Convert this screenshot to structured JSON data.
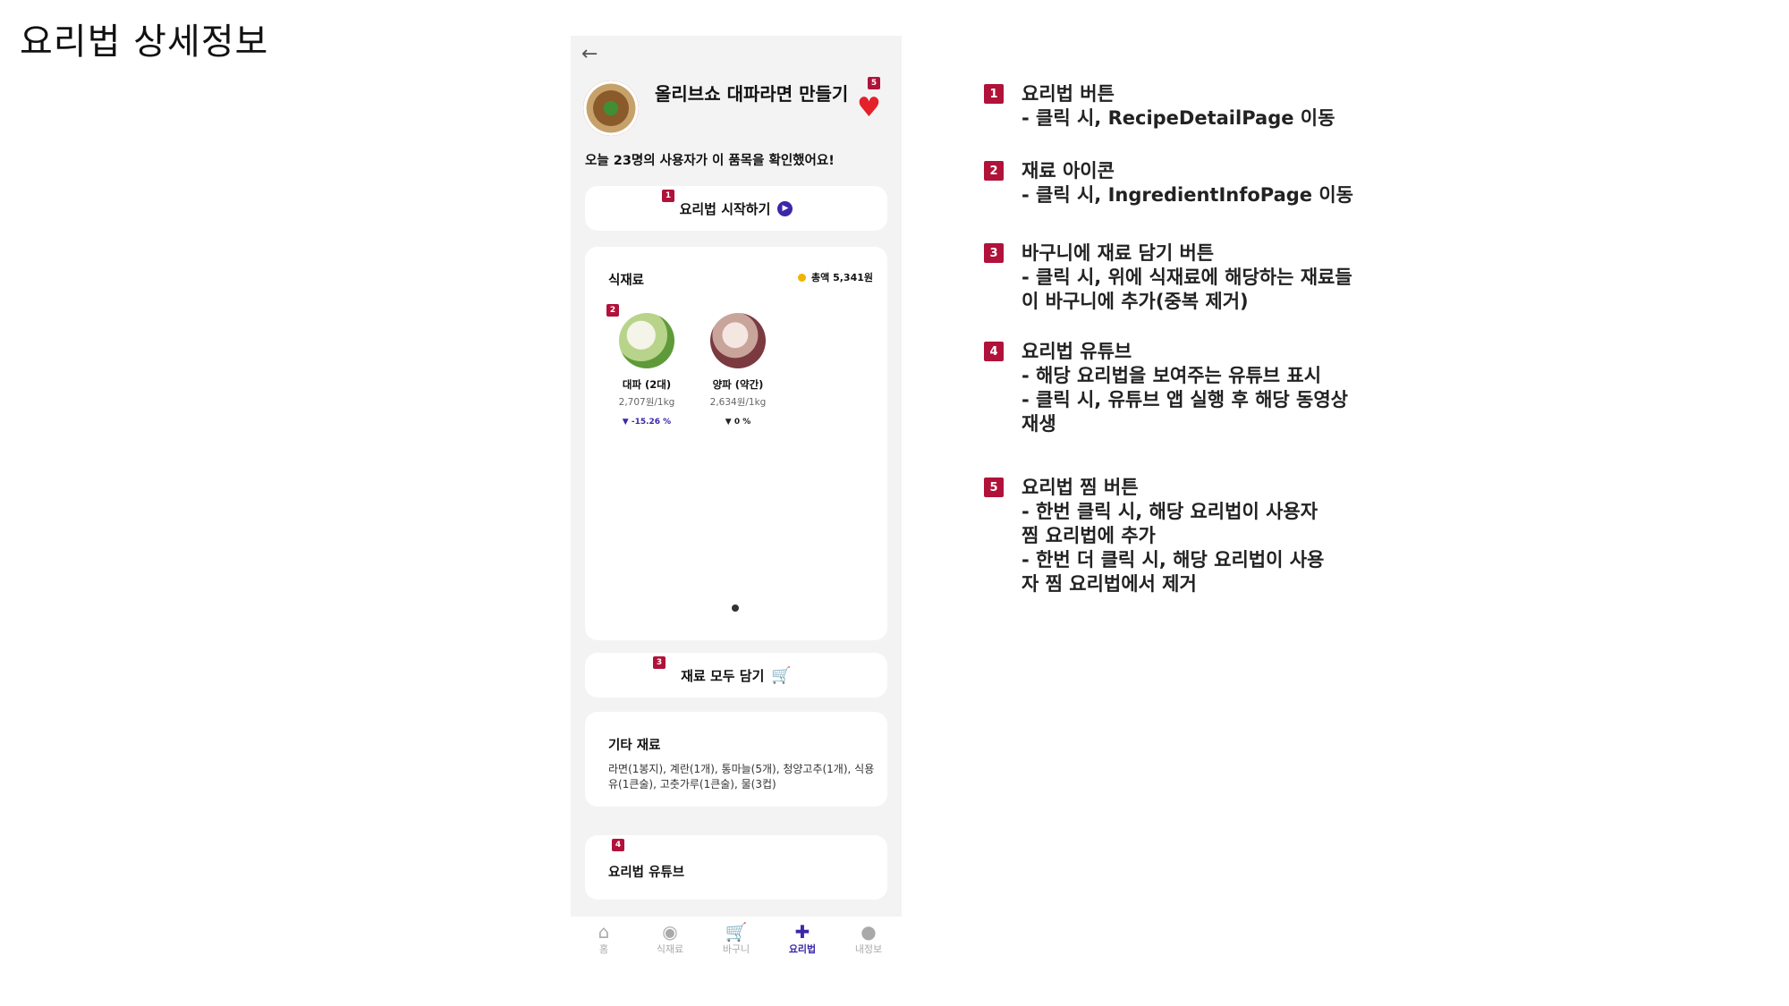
{
  "slide_title": "요리법 상세정보",
  "phone": {
    "back_icon": "arrow-left-icon",
    "recipe_title": "올리브쇼 대파라면 만들기",
    "favorite_icon": "heart-icon",
    "view_count_text": "오늘 23명의 사용자가 이 품목을 확인했어요!",
    "start_button_label": "요리법 시작하기",
    "ingredients": {
      "title": "식재료",
      "total_label": "총액 5,341원",
      "items": [
        {
          "name": "대파 (2대)",
          "price": "2,707원/1kg",
          "change": "-15.26 %"
        },
        {
          "name": "양파 (약간)",
          "price": "2,634원/1kg",
          "change": "0 %"
        }
      ]
    },
    "add_all_button_label": "재료 모두 담기",
    "etc": {
      "title": "기타 재료",
      "text": "라면(1봉지), 계란(1개), 통마늘(5개), 청양고추(1개), 식용유(1큰술), 고춧가루(1큰술), 물(3컵)"
    },
    "youtube_title": "요리법 유튜브",
    "nav": [
      {
        "label": "홈",
        "icon": "home-icon"
      },
      {
        "label": "식재료",
        "icon": "ingredient-icon"
      },
      {
        "label": "바구니",
        "icon": "cart-icon"
      },
      {
        "label": "요리법",
        "icon": "utensils-icon"
      },
      {
        "label": "내정보",
        "icon": "user-icon"
      }
    ],
    "badges": [
      "1",
      "2",
      "3",
      "4",
      "5"
    ]
  },
  "annotations": [
    {
      "num": "1",
      "lines": [
        "요리법 버튼",
        "- 클릭 시, RecipeDetailPage 이동"
      ]
    },
    {
      "num": "2",
      "lines": [
        "재료 아이콘",
        "- 클릭 시, IngredientInfoPage 이동"
      ]
    },
    {
      "num": "3",
      "lines": [
        "바구니에 재료 담기 버튼",
        "- 클릭 시, 위에 식재료에 해당하는 재료들",
        "이 바구니에 추가(중복 제거)"
      ]
    },
    {
      "num": "4",
      "lines": [
        "요리법 유튜브",
        "- 해당 요리법을 보여주는 유튜브 표시",
        "- 클릭 시, 유튜브 앱 실행 후 해당 동영상",
        "재생"
      ]
    },
    {
      "num": "5",
      "lines": [
        "요리법 찜 버튼",
        "- 한번 클릭 시, 해당 요리법이 사용자",
        "찜 요리법에 추가",
        "- 한번 더 클릭 시, 해당 요리법이 사용",
        "자 찜 요리법에서 제거"
      ]
    }
  ],
  "colors": {
    "accent": "#3a28a8",
    "badge": "#b0123a",
    "heart": "#e3212a"
  }
}
